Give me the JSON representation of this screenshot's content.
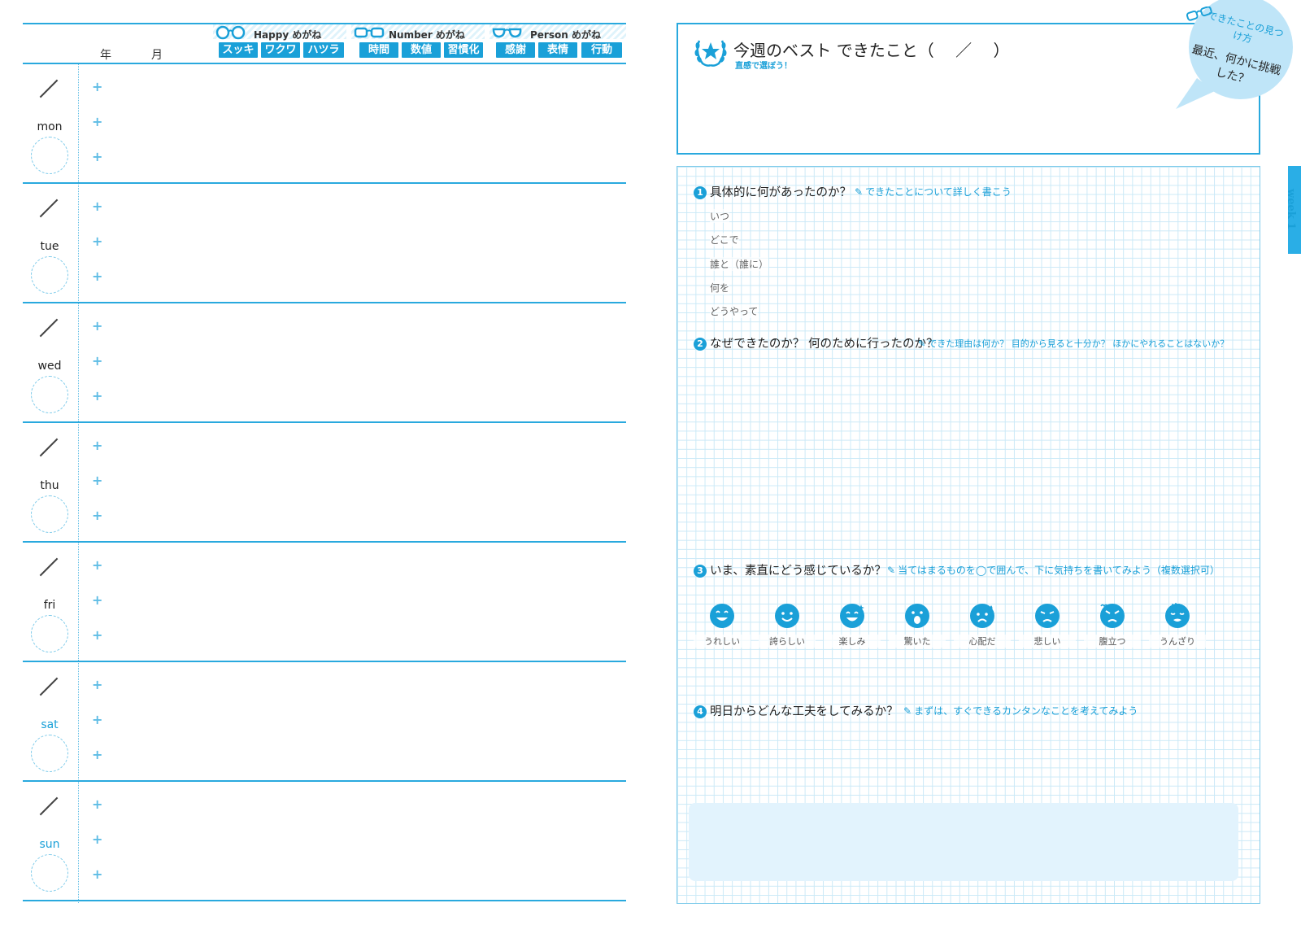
{
  "left": {
    "year_label": "年",
    "month_label": "月",
    "glasses": [
      {
        "title": "Happy めがね",
        "tags": [
          "スッキリ",
          "ワクワク",
          "ハツラツ"
        ]
      },
      {
        "title": "Number めがね",
        "tags": [
          "時間",
          "数値",
          "習慣化"
        ]
      },
      {
        "title": "Person めがね",
        "tags": [
          "感謝",
          "表情",
          "行動"
        ]
      }
    ],
    "days": [
      {
        "name": "mon",
        "slash": "／"
      },
      {
        "name": "tue",
        "slash": "／"
      },
      {
        "name": "wed",
        "slash": "／"
      },
      {
        "name": "thu",
        "slash": "／"
      },
      {
        "name": "fri",
        "slash": "／"
      },
      {
        "name": "sat",
        "slash": "／"
      },
      {
        "name": "sun",
        "slash": "／"
      }
    ],
    "bullet": "+"
  },
  "right": {
    "best_title": "今週のベスト できたこと（　 ／　 ）",
    "best_sub": "直感で選ぼう！",
    "bubble_sub": "できたことの見つけ方",
    "bubble_main": "最近、何かに挑戦した？",
    "week_label": "week 1",
    "q1": {
      "num": "1",
      "text": "具体的に何があったのか？",
      "hint": "できたことについて詳しく書こう"
    },
    "q1_fields": [
      "いつ",
      "どこで",
      "誰と（誰に）",
      "何を",
      "どうやって"
    ],
    "q2": {
      "num": "2",
      "text": "なぜできたのか？ 何のために行ったのか？",
      "hint": "できた理由は何か？ 目的から見ると十分か？ ほかにやれることはないか？"
    },
    "q3": {
      "num": "3",
      "text": "いま、素直にどう感じているか？",
      "hint": "当てはまるものを◯で囲んで、下に気持ちを書いてみよう（複数選択可）"
    },
    "emotions": [
      "うれしい",
      "誇らしい",
      "楽しみ",
      "驚いた",
      "心配だ",
      "悲しい",
      "腹立つ",
      "うんざり"
    ],
    "q4": {
      "num": "4",
      "text": "明日からどんな工夫をしてみるか？",
      "hint": "まずは、すぐできるカンタンなことを考えてみよう"
    }
  },
  "colors": {
    "accent": "#1aa0d8",
    "rule": "#29a9de",
    "grid": "#cbe9f7",
    "memo": "#e2f3fd"
  }
}
